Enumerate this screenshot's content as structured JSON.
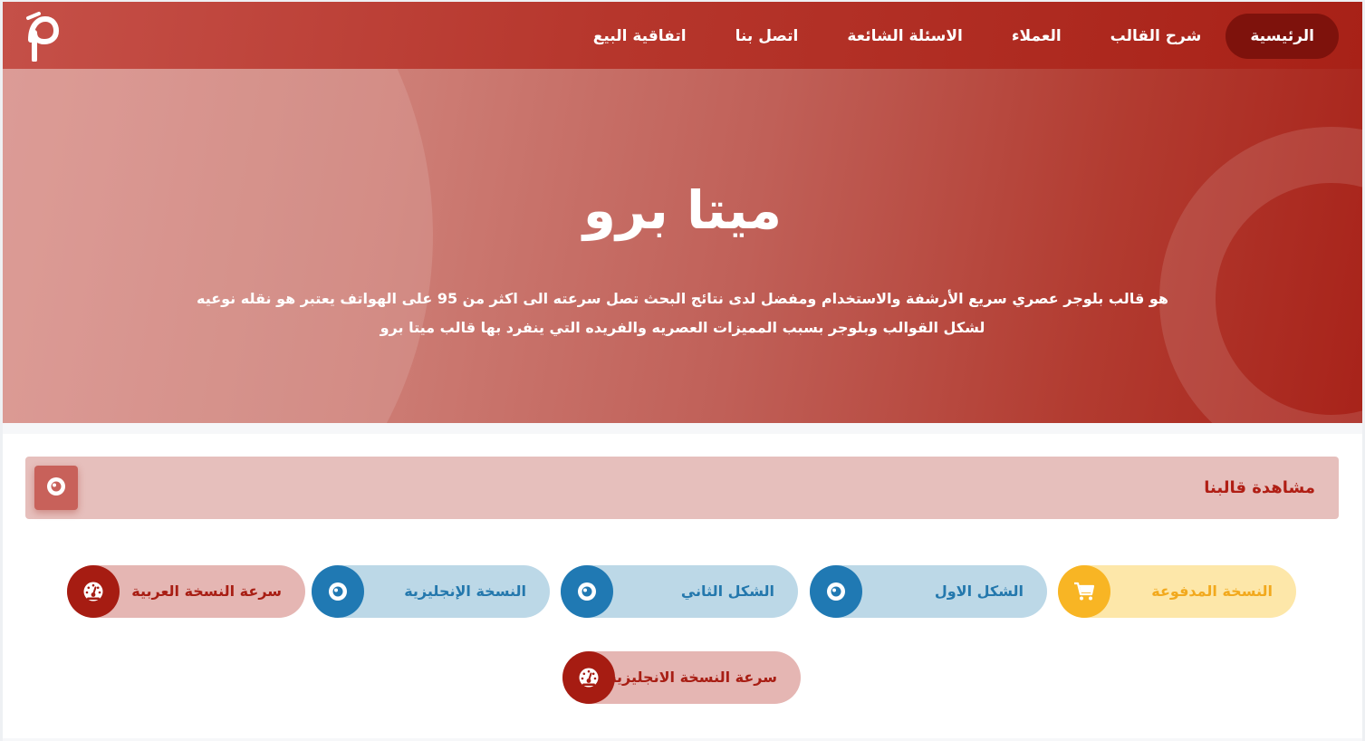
{
  "navbar": {
    "items": [
      {
        "label": "الرئيسية",
        "active": true
      },
      {
        "label": "شرح القالب",
        "active": false
      },
      {
        "label": "العملاء",
        "active": false
      },
      {
        "label": "الاسئلة الشائعة",
        "active": false
      },
      {
        "label": "اتصل بنا",
        "active": false
      },
      {
        "label": "اتفاقية البيع",
        "active": false
      }
    ],
    "logo_icon": "meta-logo-icon"
  },
  "hero": {
    "title": "ميتا برو",
    "description": "هو قالب بلوجر عصري سريع الأرشفة والاستخدام ومفضل لدى نتائج البحث تصل سرعته الى اكثر من 95 على الهواتف يعتبر هو نقله نوعيه لشكل القوالب وبلوجر بسبب المميزات العصريه والفريده التي ينفرد بها قالب ميتا برو"
  },
  "watch": {
    "label": "مشاهدة قالبنا",
    "icon": "eye-icon"
  },
  "buttons": [
    {
      "label": "النسخة المدفوعة",
      "icon": "cart-icon",
      "color": "#f8b524"
    },
    {
      "label": "الشكل الاول",
      "icon": "eye-icon",
      "color": "#2079b3"
    },
    {
      "label": "الشكل الثاني",
      "icon": "eye-icon",
      "color": "#2079b3"
    },
    {
      "label": "النسخة الإنجليزية",
      "icon": "eye-icon",
      "color": "#2079b3"
    },
    {
      "label": "سرعة النسخة العربية",
      "icon": "speedometer-icon",
      "color": "#a61c12"
    },
    {
      "label": "سرعة النسخة الانجليزية",
      "icon": "speedometer-icon",
      "color": "#a61c12"
    }
  ]
}
